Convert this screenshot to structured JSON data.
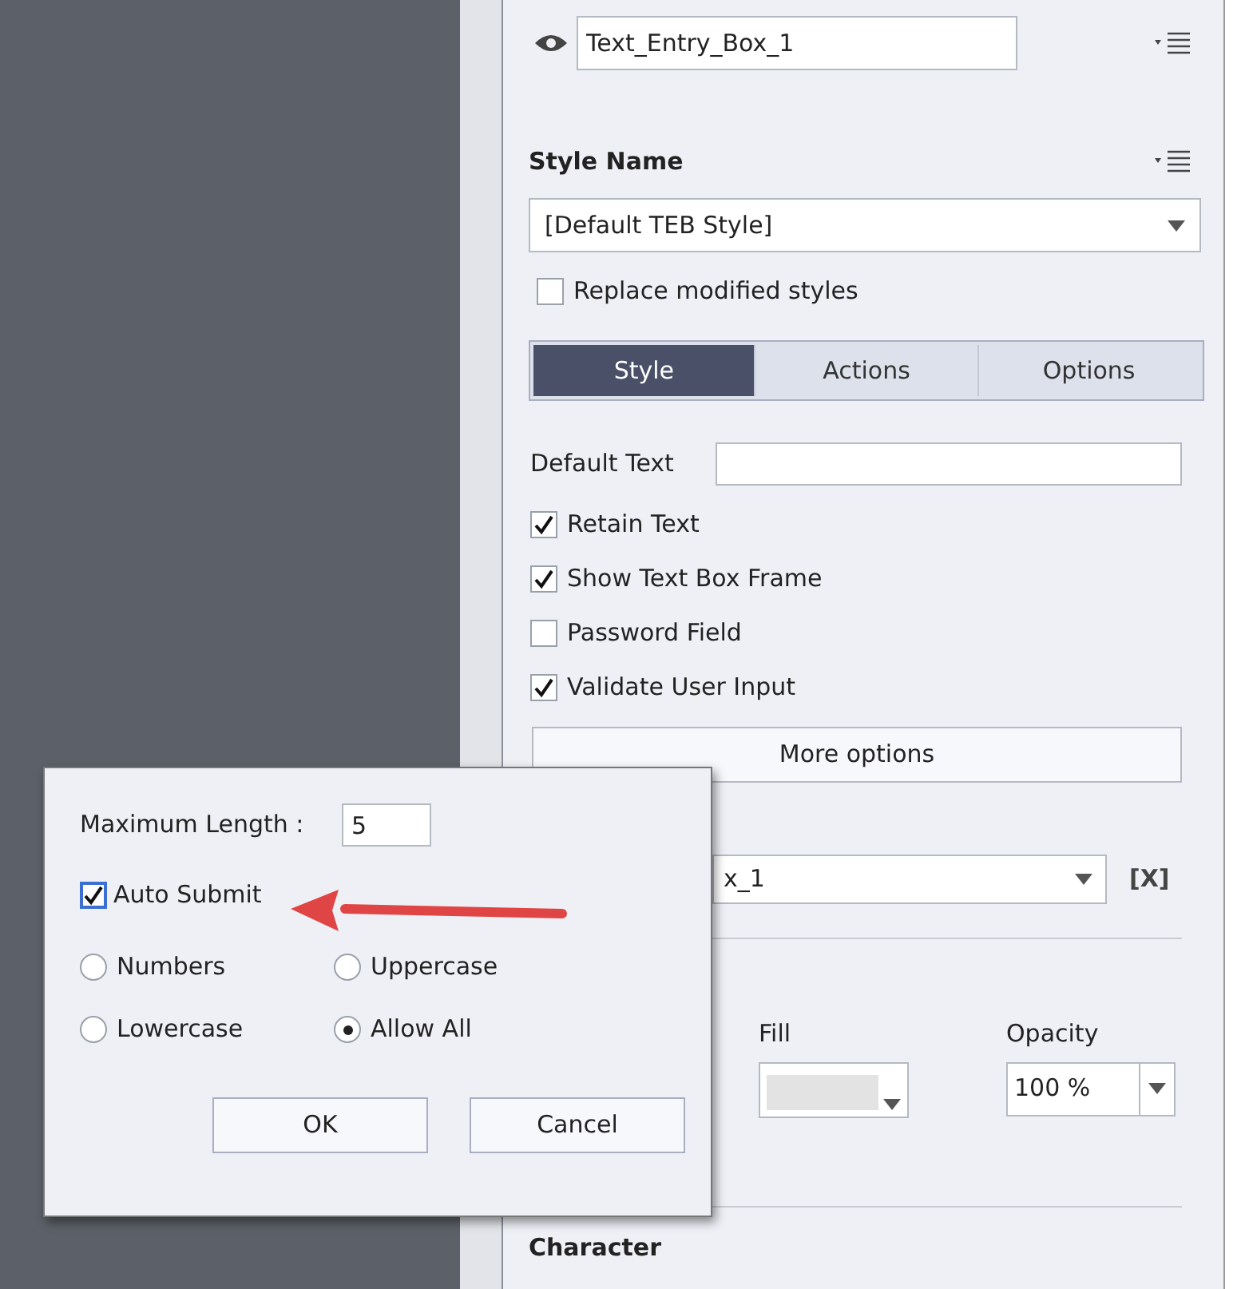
{
  "object_name": {
    "value": "Text_Entry_Box_1"
  },
  "style": {
    "heading": "Style Name",
    "select": "[Default TEB Style]",
    "replace": {
      "label": "Replace modified styles",
      "checked": false
    }
  },
  "tabs": [
    {
      "label": "Style",
      "selected": true
    },
    {
      "label": "Actions",
      "selected": false
    },
    {
      "label": "Options",
      "selected": false
    }
  ],
  "default_text": {
    "label": "Default Text"
  },
  "options": [
    {
      "label": "Retain Text",
      "checked": true
    },
    {
      "label": "Show Text Box Frame",
      "checked": true
    },
    {
      "label": "Password Field",
      "checked": false
    },
    {
      "label": "Validate User Input",
      "checked": true
    }
  ],
  "more_button": "More options",
  "variable_select": {
    "value": "x_1"
  },
  "clear_button": "[X]",
  "fill": {
    "label": "Fill"
  },
  "opacity": {
    "label": "Opacity",
    "value": "100 %"
  },
  "character_heading": "Character",
  "dialog": {
    "max_length": {
      "label": "Maximum Length :",
      "value": "5"
    },
    "auto_submit": {
      "label": "Auto Submit",
      "checked": true
    },
    "filters": [
      {
        "label": "Numbers",
        "selected": false
      },
      {
        "label": "Uppercase",
        "selected": false
      },
      {
        "label": "Lowercase",
        "selected": false
      },
      {
        "label": "Allow All",
        "selected": true
      }
    ],
    "buttons": [
      "OK",
      "Cancel"
    ]
  }
}
